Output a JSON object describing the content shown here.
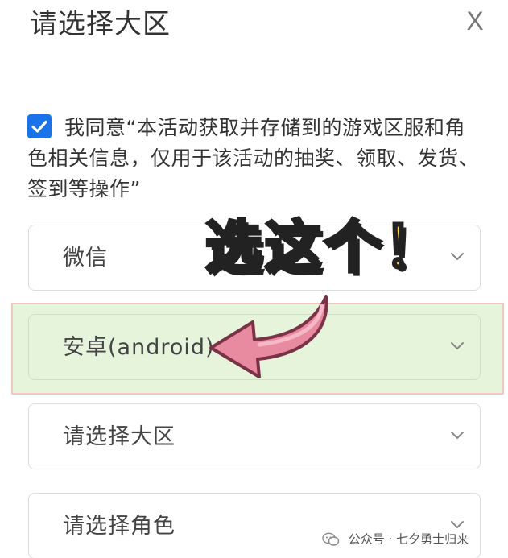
{
  "dialog": {
    "title": "请选择大区",
    "close_label": "X"
  },
  "agreement": {
    "checked": true,
    "text": "我同意“本活动获取并存储到的游戏区服和角色相关信息，仅用于该活动的抽奖、领取、发货、签到等操作”"
  },
  "fields": {
    "platform": {
      "value": "微信"
    },
    "system": {
      "value": "安卓(android)"
    },
    "region": {
      "placeholder": "请选择大区"
    },
    "role": {
      "placeholder": "请选择角色"
    }
  },
  "annotation": {
    "callout_text": "选这个！",
    "arrow_color": "#e88aa0",
    "highlight_color": "#e6f4dc"
  },
  "watermark": {
    "text": "公众号 · 七夕勇士归来"
  },
  "colors": {
    "accent": "#1a73e8",
    "callout_fill": "#ffd84a"
  }
}
